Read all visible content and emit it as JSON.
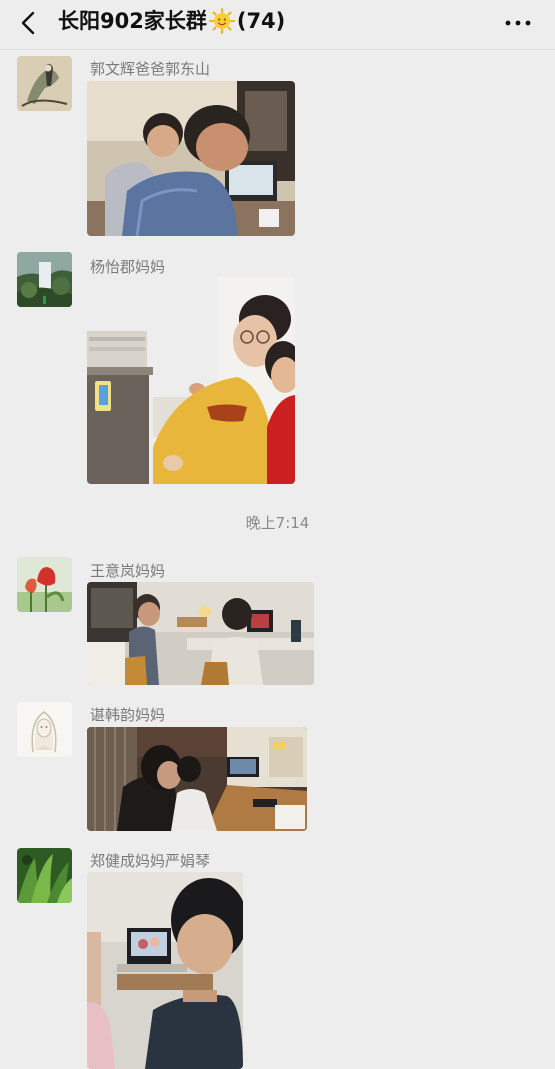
{
  "header": {
    "title_prefix": "长阳902家长群",
    "member_count": "(74)",
    "title_emoji_icon": "sun-face-icon",
    "back_icon": "chevron-left-icon",
    "more_icon": "more-dots-icon"
  },
  "messages": [
    {
      "sender": "郭文辉爸爸郭东山",
      "avatar": "ink-painting-avatar",
      "photo": "father-and-son-at-computer-photo"
    },
    {
      "sender": "杨怡郡妈妈",
      "avatar": "waterfall-avatar",
      "photo": "girl-in-yellow-at-desk-photo"
    },
    {
      "sender": "王意岚妈妈",
      "avatar": "tulip-avatar",
      "photo": "family-watching-monitor-photo"
    },
    {
      "sender": "谌韩韵妈妈",
      "avatar": "sketch-girl-avatar",
      "photo": "students-at-laptop-photo"
    },
    {
      "sender": "郑健成妈妈严娟琴",
      "avatar": "green-plants-avatar",
      "photo": "boy-watching-laptop-photo"
    }
  ],
  "timestamp": "晚上7:14",
  "colors": {
    "background": "#ededed",
    "title": "#111111",
    "sender_name": "#7a7a7a",
    "timestamp": "#8a8a8a"
  }
}
